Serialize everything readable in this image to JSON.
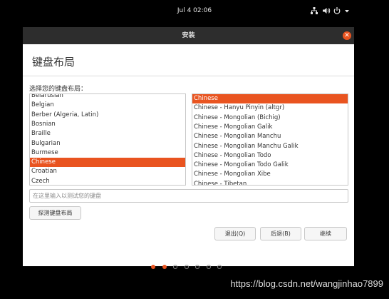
{
  "topbar": {
    "clock": "Jul 4  02:06"
  },
  "icons": {
    "network": "network-icon",
    "volume": "volume-icon",
    "power": "power-icon",
    "menu_arrow": "chevron-down-icon",
    "close": "close-icon"
  },
  "window": {
    "title": "安装"
  },
  "page": {
    "heading": "键盘布局",
    "prompt": "选择您的键盘布局："
  },
  "layouts": [
    {
      "label": "Belarusian"
    },
    {
      "label": "Belgian"
    },
    {
      "label": "Berber (Algeria, Latin)"
    },
    {
      "label": "Bosnian"
    },
    {
      "label": "Braille"
    },
    {
      "label": "Bulgarian"
    },
    {
      "label": "Burmese"
    },
    {
      "label": "Chinese",
      "selected": true
    },
    {
      "label": "Croatian"
    },
    {
      "label": "Czech"
    }
  ],
  "variants": [
    {
      "label": "Chinese",
      "selected": true
    },
    {
      "label": "Chinese - Hanyu Pinyin (altgr)"
    },
    {
      "label": "Chinese - Mongolian (Bichig)"
    },
    {
      "label": "Chinese - Mongolian Galik"
    },
    {
      "label": "Chinese - Mongolian Manchu"
    },
    {
      "label": "Chinese - Mongolian Manchu Galik"
    },
    {
      "label": "Chinese - Mongolian Todo"
    },
    {
      "label": "Chinese - Mongolian Todo Galik"
    },
    {
      "label": "Chinese - Mongolian Xibe"
    },
    {
      "label": "Chinese - Tibetan"
    }
  ],
  "test_input": {
    "placeholder": "在这里输入以测试您的键盘",
    "value": ""
  },
  "buttons": {
    "detect": "探测键盘布局",
    "quit": "退出(Q)",
    "back": "后退(B)",
    "continue": "继续"
  },
  "progress": {
    "total_steps": 7,
    "current_step": 2
  },
  "colors": {
    "accent": "#e95420",
    "titlebar": "#2d2d2d"
  },
  "watermark": "https://blog.csdn.net/wangjinhao7899"
}
